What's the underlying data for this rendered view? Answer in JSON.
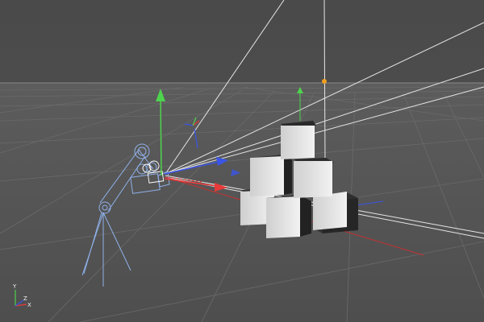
{
  "viewport": {
    "background_color": "#4b4b4b",
    "floor_color": "#555555",
    "grid_line_color": "#6c6c6c",
    "horizon_color": "#8a8a8a",
    "wireframe_color": "#8fb0e8",
    "camera_ray_color": "#e6e6e6",
    "cube_count": 6
  },
  "axis_colors": {
    "x": "#e83a3a",
    "y": "#4ed34e",
    "z": "#3a55e8",
    "handle": "#f0a020"
  },
  "world_axis_indicator": {
    "x_label": "X",
    "y_label": "Y",
    "z_label": "Z"
  },
  "icons": [
    "camera-crane-icon",
    "camera-icon",
    "move-gizmo-icon",
    "world-axis-icon"
  ]
}
